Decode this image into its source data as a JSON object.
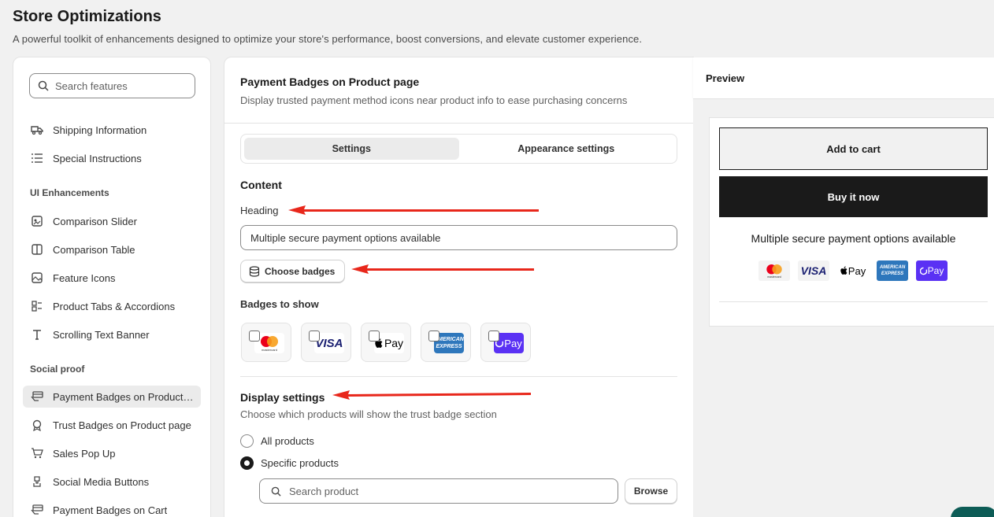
{
  "page": {
    "title": "Store Optimizations",
    "subtitle": "A powerful toolkit of enhancements designed to optimize your store's performance, boost conversions, and elevate customer experience."
  },
  "sidebar": {
    "search_placeholder": "Search features",
    "items_top": [
      {
        "label": "Shipping Information",
        "icon": "truck-icon"
      },
      {
        "label": "Special Instructions",
        "icon": "list-icon"
      }
    ],
    "section_ui": "UI Enhancements",
    "items_ui": [
      {
        "label": "Comparison Slider",
        "icon": "slider-icon"
      },
      {
        "label": "Comparison Table",
        "icon": "columns-icon"
      },
      {
        "label": "Feature Icons",
        "icon": "image-icon"
      },
      {
        "label": "Product Tabs & Accordions",
        "icon": "tabs-icon"
      },
      {
        "label": "Scrolling Text Banner",
        "icon": "text-icon"
      }
    ],
    "section_social": "Social proof",
    "items_social": [
      {
        "label": "Payment Badges on Product page",
        "icon": "card-hand-icon",
        "active": true
      },
      {
        "label": "Trust Badges on Product page",
        "icon": "ribbon-icon"
      },
      {
        "label": "Sales Pop Up",
        "icon": "cart-icon"
      },
      {
        "label": "Social Media Buttons",
        "icon": "share-icon"
      },
      {
        "label": "Payment Badges on Cart",
        "icon": "card-icon"
      }
    ]
  },
  "main": {
    "title": "Payment Badges on Product page",
    "subtitle": "Display trusted payment method icons near product info to ease purchasing concerns",
    "tabs": [
      {
        "label": "Settings",
        "active": true
      },
      {
        "label": "Appearance settings",
        "active": false
      }
    ],
    "content_heading": "Content",
    "heading_label": "Heading",
    "heading_value": "Multiple secure payment options available",
    "choose_badges_label": "Choose badges",
    "badges_to_show_label": "Badges to show",
    "badges": [
      {
        "name": "mastercard",
        "checked": false
      },
      {
        "name": "visa",
        "checked": false
      },
      {
        "name": "apple-pay",
        "checked": false
      },
      {
        "name": "american-express",
        "checked": false
      },
      {
        "name": "shop-pay",
        "checked": false
      }
    ],
    "display_heading": "Display settings",
    "display_sub": "Choose which products will show the trust badge section",
    "radio_all": "All products",
    "radio_specific": "Specific products",
    "selected_radio": "Specific products",
    "product_search_placeholder": "Search product",
    "browse_label": "Browse"
  },
  "preview": {
    "title": "Preview",
    "add_to_cart": "Add to cart",
    "buy_now": "Buy it now",
    "heading": "Multiple secure payment options available",
    "badges": [
      "mastercard",
      "visa",
      "apple-pay",
      "american-express",
      "shop-pay"
    ]
  },
  "badge_text": {
    "mastercard_small": "mastercard",
    "visa": "VISA",
    "apple_pay": "Pay",
    "amex_line1": "AMERICAN",
    "amex_line2": "EXPRESS",
    "shop_pay": "Pay"
  },
  "colors": {
    "accent_dark": "#1a1a1a",
    "annotation_arrow": "#e8271b",
    "shop_pay_purple": "#5a31f4",
    "amex_blue": "#2e77bc",
    "visa_blue": "#1a1f71"
  }
}
